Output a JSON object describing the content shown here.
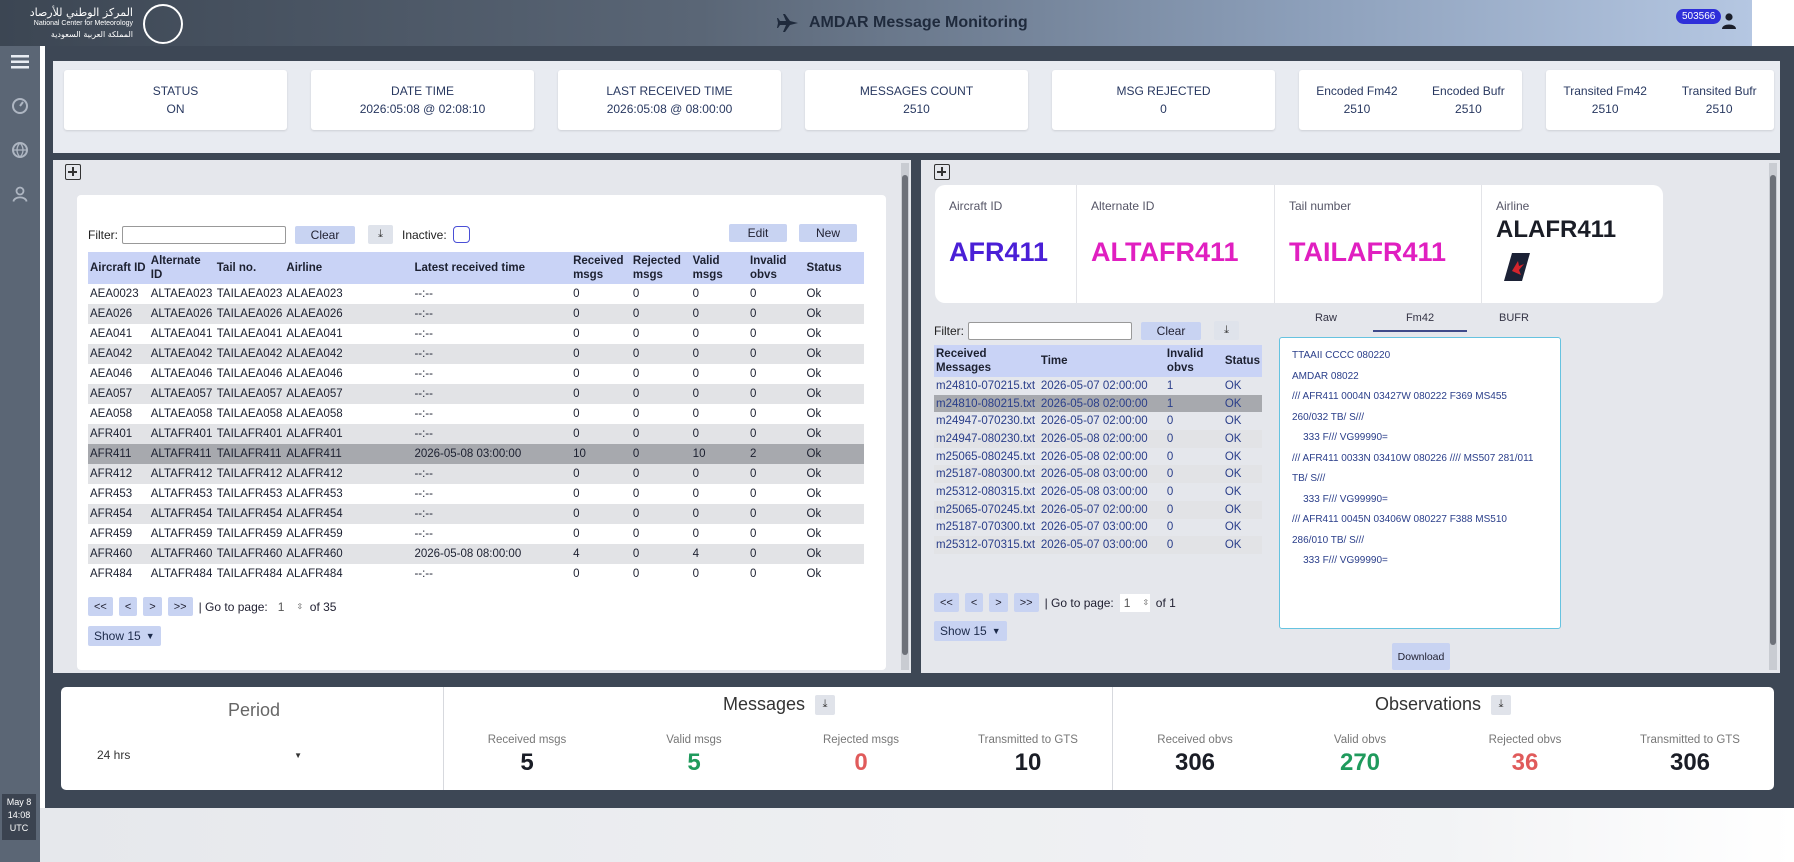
{
  "header": {
    "logo_ar": "المركز الوطني للأرصاد",
    "logo_en": "National Center for Meteorology",
    "logo_ar2": "المملكة العربية السعودية",
    "title": "AMDAR Message Monitoring",
    "user_badge": "503566",
    "icons": {
      "title": "airplane-icon",
      "user": "user-icon"
    }
  },
  "clock": {
    "date": "May 8",
    "time": "14:08",
    "tz": "UTC"
  },
  "stats": {
    "status_label": "STATUS",
    "status_value": "ON",
    "datetime_label": "DATE TIME",
    "datetime_value": "2026:05:08 @ 02:08:10",
    "last_label": "LAST RECEIVED TIME",
    "last_value": "2026:05:08 @ 08:00:00",
    "count_label": "MESSAGES COUNT",
    "count_value": "2510",
    "rejected_label": "MSG REJECTED",
    "rejected_value": "0",
    "enc_fm42_label": "Encoded Fm42",
    "enc_fm42_value": "2510",
    "enc_bufr_label": "Encoded Bufr",
    "enc_bufr_value": "2510",
    "tr_fm42_label": "Transited Fm42",
    "tr_fm42_value": "2510",
    "tr_bufr_label": "Transited Bufr",
    "tr_bufr_value": "2510"
  },
  "aircraft": {
    "filter_label": "Filter:",
    "clear_label": "Clear",
    "inactive_label": "Inactive:",
    "edit_label": "Edit",
    "new_label": "New",
    "columns": [
      "Aircraft ID",
      "Alternate ID",
      "Tail no.",
      "Airline",
      "Latest received time",
      "Received msgs",
      "Rejected msgs",
      "Valid msgs",
      "Invalid obvs",
      "Status"
    ],
    "rows": [
      [
        "AEA0023",
        "ALTAEA023",
        "TAILAEA023",
        "ALAEA023",
        "--:--",
        "0",
        "0",
        "0",
        "0",
        "Ok"
      ],
      [
        "AEA026",
        "ALTAEA026",
        "TAILAEA026",
        "ALAEA026",
        "--:--",
        "0",
        "0",
        "0",
        "0",
        "Ok"
      ],
      [
        "AEA041",
        "ALTAEA041",
        "TAILAEA041",
        "ALAEA041",
        "--:--",
        "0",
        "0",
        "0",
        "0",
        "Ok"
      ],
      [
        "AEA042",
        "ALTAEA042",
        "TAILAEA042",
        "ALAEA042",
        "--:--",
        "0",
        "0",
        "0",
        "0",
        "Ok"
      ],
      [
        "AEA046",
        "ALTAEA046",
        "TAILAEA046",
        "ALAEA046",
        "--:--",
        "0",
        "0",
        "0",
        "0",
        "Ok"
      ],
      [
        "AEA057",
        "ALTAEA057",
        "TAILAEA057",
        "ALAEA057",
        "--:--",
        "0",
        "0",
        "0",
        "0",
        "Ok"
      ],
      [
        "AEA058",
        "ALTAEA058",
        "TAILAEA058",
        "ALAEA058",
        "--:--",
        "0",
        "0",
        "0",
        "0",
        "Ok"
      ],
      [
        "AFR401",
        "ALTAFR401",
        "TAILAFR401",
        "ALAFR401",
        "--:--",
        "0",
        "0",
        "0",
        "0",
        "Ok"
      ],
      [
        "AFR411",
        "ALTAFR411",
        "TAILAFR411",
        "ALAFR411",
        "2026-05-08 03:00:00",
        "10",
        "0",
        "10",
        "2",
        "Ok"
      ],
      [
        "AFR412",
        "ALTAFR412",
        "TAILAFR412",
        "ALAFR412",
        "--:--",
        "0",
        "0",
        "0",
        "0",
        "Ok"
      ],
      [
        "AFR453",
        "ALTAFR453",
        "TAILAFR453",
        "ALAFR453",
        "--:--",
        "0",
        "0",
        "0",
        "0",
        "Ok"
      ],
      [
        "AFR454",
        "ALTAFR454",
        "TAILAFR454",
        "ALAFR454",
        "--:--",
        "0",
        "0",
        "0",
        "0",
        "Ok"
      ],
      [
        "AFR459",
        "ALTAFR459",
        "TAILAFR459",
        "ALAFR459",
        "--:--",
        "0",
        "0",
        "0",
        "0",
        "Ok"
      ],
      [
        "AFR460",
        "ALTAFR460",
        "TAILAFR460",
        "ALAFR460",
        "2026-05-08 08:00:00",
        "4",
        "0",
        "4",
        "0",
        "Ok"
      ],
      [
        "AFR484",
        "ALTAFR484",
        "TAILAFR484",
        "ALAFR484",
        "--:--",
        "0",
        "0",
        "0",
        "0",
        "Ok"
      ]
    ],
    "pager": {
      "first": "<<",
      "prev": "<",
      "next": ">",
      "last": ">>",
      "goto_label": "| Go to page:",
      "page": "1",
      "of_label": "of 35"
    },
    "show_label": "Show 15"
  },
  "detail": {
    "aircraft_id_label": "Aircraft ID",
    "aircraft_id": "AFR411",
    "alternate_id_label": "Alternate ID",
    "alternate_id": "ALTAFR411",
    "tail_label": "Tail number",
    "tail": "TAILAFR411",
    "airline_label": "Airline",
    "airline": "ALAFR411",
    "filter_label": "Filter:",
    "clear_label": "Clear",
    "columns": [
      "Received Messages",
      "Time",
      "Invalid obvs",
      "Status"
    ],
    "rows": [
      [
        "m24810-070215.txt",
        "2026-05-07 02:00:00",
        "1",
        "OK"
      ],
      [
        "m24810-080215.txt",
        "2026-05-08 02:00:00",
        "1",
        "OK"
      ],
      [
        "m24947-070230.txt",
        "2026-05-07 02:00:00",
        "0",
        "OK"
      ],
      [
        "m24947-080230.txt",
        "2026-05-08 02:00:00",
        "0",
        "OK"
      ],
      [
        "m25065-080245.txt",
        "2026-05-08 02:00:00",
        "0",
        "OK"
      ],
      [
        "m25187-080300.txt",
        "2026-05-08 03:00:00",
        "0",
        "OK"
      ],
      [
        "m25312-080315.txt",
        "2026-05-08 03:00:00",
        "0",
        "OK"
      ],
      [
        "m25065-070245.txt",
        "2026-05-07 02:00:00",
        "0",
        "OK"
      ],
      [
        "m25187-070300.txt",
        "2026-05-07 03:00:00",
        "0",
        "OK"
      ],
      [
        "m25312-070315.txt",
        "2026-05-07 03:00:00",
        "0",
        "OK"
      ]
    ],
    "pager": {
      "first": "<<",
      "prev": "<",
      "next": ">",
      "last": ">>",
      "goto_label": "| Go to page:",
      "page": "1",
      "of_label": "of 1"
    },
    "show_label": "Show 15",
    "tabs": [
      "Raw",
      "Fm42",
      "BUFR"
    ],
    "active_tab": "Fm42",
    "message_text": "TTAAII CCCC 080220\nAMDAR 08022\n/// AFR411 0004N 03427W 080222 F369 MS455\n260/032 TB/ S///\n    333 F/// VG99990=\n/// AFR411 0033N 03410W 080226 //// MS507 281/011\nTB/ S///\n    333 F/// VG99990=\n/// AFR411 0045N 03406W 080227 F388 MS510\n286/010 TB/ S///\n    333 F/// VG99990=",
    "download_label": "Download"
  },
  "summary": {
    "period_label": "Period",
    "period_value": "24 hrs",
    "messages_title": "Messages",
    "observations_title": "Observations",
    "msg_received_label": "Received msgs",
    "msg_received": "5",
    "msg_valid_label": "Valid msgs",
    "msg_valid": "5",
    "msg_rejected_label": "Rejected msgs",
    "msg_rejected": "0",
    "msg_gts_label": "Transmitted to GTS",
    "msg_gts": "10",
    "obs_received_label": "Received obvs",
    "obs_received": "306",
    "obs_valid_label": "Valid obvs",
    "obs_valid": "270",
    "obs_rejected_label": "Rejected obvs",
    "obs_rejected": "36",
    "obs_gts_label": "Transmitted to GTS",
    "obs_gts": "306"
  },
  "colors": {
    "aircraft_id": "#4a1fd6",
    "alternate_id": "#e01fc0",
    "tail": "#e01fc0",
    "valid_green": "#1f9a5c",
    "rejected_red": "#e05b5b"
  }
}
